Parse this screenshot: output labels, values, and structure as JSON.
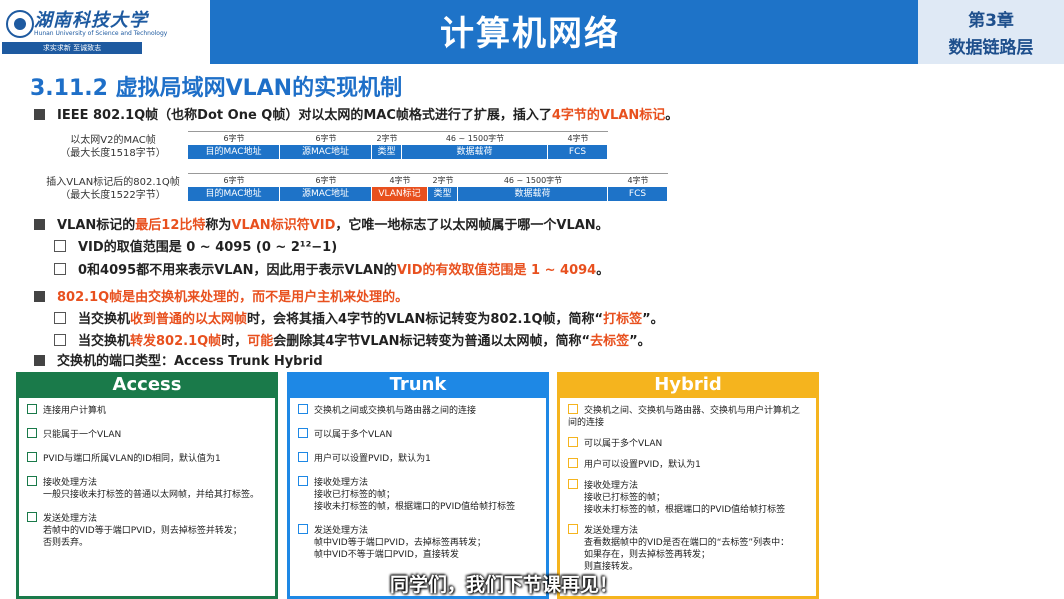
{
  "header": {
    "logo_name": "湖南科技大学",
    "logo_en": "Hunan University of Science and Technology",
    "motto": "求实求新   至诚致志",
    "title": "计算机网络",
    "chapter_num": "第3章",
    "chapter_name": "数据链路层"
  },
  "section_title": "3.11.2 虚拟局域网VLAN的实现机制",
  "bullets": {
    "b1_pre": "IEEE 802.1Q帧（也称Dot One Q帧）对以太网的MAC帧格式进行了扩展，插入了",
    "b1_red": "4字节的VLAN标记",
    "b1_post": "。",
    "b2_pre": "VLAN标记的",
    "b2_red1": "最后12比特",
    "b2_mid": "称为",
    "b2_red2": "VLAN标识符VID",
    "b2_post": "，它唯一地标志了以太网帧属于哪一个VLAN。",
    "b2a": "VID的取值范围是 0 ~ 4095 (0 ~ 2¹²−1)",
    "b2b_pre": "0和4095都不用来表示VLAN，因此用于表示VLAN的",
    "b2b_red": "VID的有效取值范围是 1 ~ 4094",
    "b2b_post": "。",
    "b3_red": "802.1Q帧是由交换机来处理的，而不是用户主机来处理的。",
    "b3a_pre": "当交换机",
    "b3a_red1": "收到普通的以太网帧",
    "b3a_mid": "时，会将其插入4字节的VLAN标记转变为802.1Q帧，简称“",
    "b3a_red2": "打标签",
    "b3a_post": "”。",
    "b3b_pre": "当交换机",
    "b3b_red1": "转发802.1Q帧",
    "b3b_mid1": "时，",
    "b3b_red2": "可能",
    "b3b_mid2": "会删除其4字节VLAN标记转变为普通以太网帧，简称“",
    "b3b_red3": "去标签",
    "b3b_post": "”。",
    "b4": "交换机的端口类型：Access  Trunk  Hybrid"
  },
  "frame1": {
    "label1": "以太网V2的MAC帧",
    "label2": "（最大长度1518字节）",
    "cells": [
      {
        "size": "6字节",
        "name": "目的MAC地址"
      },
      {
        "size": "6字节",
        "name": "源MAC地址"
      },
      {
        "size": "2字节",
        "name": "类型"
      },
      {
        "size": "46 ~ 1500字节",
        "name": "数据载荷"
      },
      {
        "size": "4字节",
        "name": "FCS"
      }
    ]
  },
  "frame2": {
    "label1": "插入VLAN标记后的802.1Q帧",
    "label2": "（最大长度1522字节）",
    "cells": [
      {
        "size": "6字节",
        "name": "目的MAC地址"
      },
      {
        "size": "6字节",
        "name": "源MAC地址"
      },
      {
        "size": "4字节",
        "name": "VLAN标记"
      },
      {
        "size": "2字节",
        "name": "类型"
      },
      {
        "size": "46 ~ 1500字节",
        "name": "数据载荷"
      },
      {
        "size": "4字节",
        "name": "FCS"
      }
    ]
  },
  "boxes": {
    "access": {
      "title": "Access",
      "i1": "连接用户计算机",
      "i2": "只能属于一个VLAN",
      "i3": "PVID与端口所属VLAN的ID相同，默认值为1",
      "i4": "接收处理方法",
      "i4a": "一般只接收未打标签的普通以太网帧，并给其打标签。",
      "i5": "发送处理方法",
      "i5a": "若帧中的VID等于端口PVID，则去掉标签并转发；",
      "i5b": "否则丢弃。"
    },
    "trunk": {
      "title": "Trunk",
      "i1": "交换机之间或交换机与路由器之间的连接",
      "i2": "可以属于多个VLAN",
      "i3": "用户可以设置PVID，默认为1",
      "i4": "接收处理方法",
      "i4a": "接收已打标签的帧；",
      "i4b": "接收未打标签的帧，根据端口的PVID值给帧打标签",
      "i5": "发送处理方法",
      "i5a": "帧中VID等于端口PVID，去掉标签再转发；",
      "i5b": "帧中VID不等于端口PVID，直接转发"
    },
    "hybrid": {
      "title": "Hybrid",
      "i1": "交换机之间、交换机与路由器、交换机与用户计算机之间的连接",
      "i2": "可以属于多个VLAN",
      "i3": "用户可以设置PVID，默认为1",
      "i4": "接收处理方法",
      "i4a": "接收已打标签的帧；",
      "i4b": "接收未打标签的帧，根据端口的PVID值给帧打标签",
      "i5": "发送处理方法",
      "i5a": "查看数据帧中的VID是否在端口的“去标签”列表中：",
      "i5b": "如果存在，则去掉标签再转发；",
      "i5c": "则直接转发。"
    }
  },
  "caption": "同学们，我们下节课再见！",
  "colors": {
    "blue": "#1e73c8",
    "red": "#e8501e",
    "green": "#1a7a4a",
    "trunk": "#1e88e5",
    "hybrid": "#f5b41e"
  }
}
